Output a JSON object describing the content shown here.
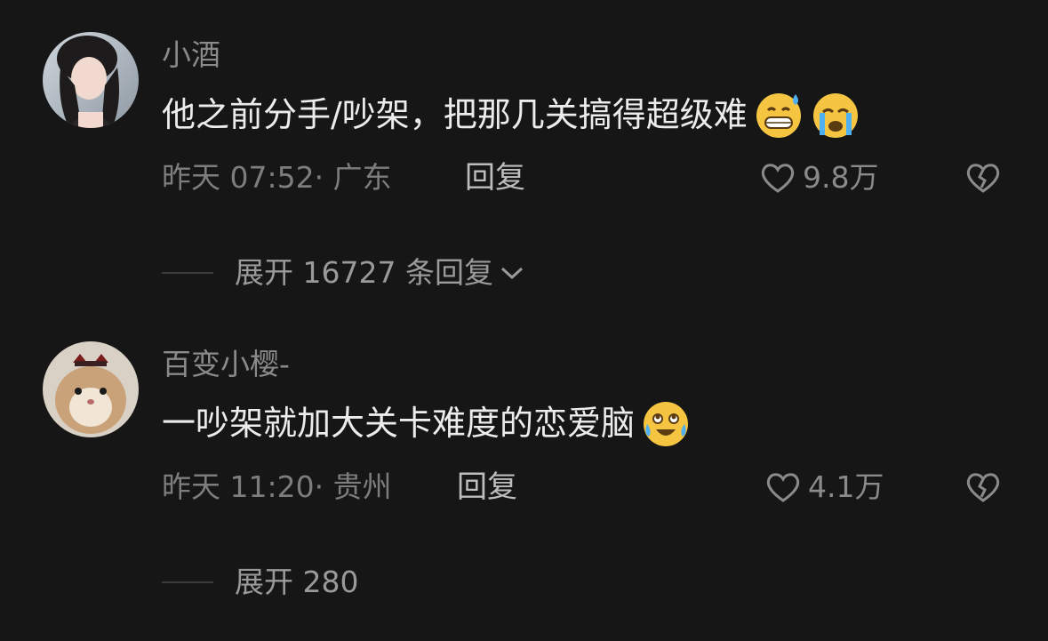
{
  "comments": [
    {
      "username": "小酒",
      "text": "他之前分手/吵架，把那几关搞得超级难",
      "emojis": [
        "sweat-grin-emoji",
        "loud-crying-emoji"
      ],
      "meta": "昨天 07:52· 广东",
      "reply_label": "回复",
      "likes": "9.8万",
      "expand_label": "展开 16727 条回复",
      "avatar": "avatar-woman-icon"
    },
    {
      "username": "百变小樱-",
      "text": "一吵架就加大关卡难度的恋爱脑",
      "emojis": [
        "tears-of-joy-emoji"
      ],
      "meta": "昨天 11:20· 贵州",
      "reply_label": "回复",
      "likes": "4.1万",
      "expand_label": "展开 280",
      "avatar": "avatar-hamster-icon"
    }
  ],
  "colors": {
    "background": "#161616",
    "text_primary": "#ececec",
    "text_secondary": "#8a8a8a"
  }
}
